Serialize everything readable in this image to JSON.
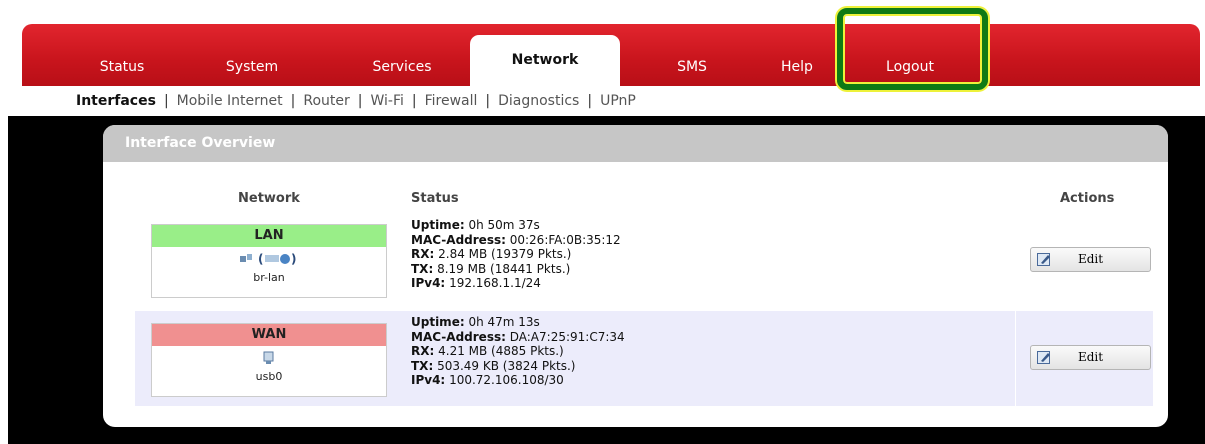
{
  "nav": {
    "tabs": [
      {
        "label": "Status"
      },
      {
        "label": "System"
      },
      {
        "label": "Services"
      },
      {
        "label": "Network",
        "active": true
      },
      {
        "label": "SMS"
      },
      {
        "label": "Help"
      },
      {
        "label": "Logout"
      }
    ]
  },
  "submenu": {
    "items": [
      "Interfaces",
      "Mobile Internet",
      "Router",
      "Wi-Fi",
      "Firewall",
      "Diagnostics",
      "UPnP"
    ],
    "active": "Interfaces"
  },
  "panel": {
    "title": "Interface Overview",
    "columns": {
      "network": "Network",
      "status": "Status",
      "actions": "Actions"
    },
    "rows": [
      {
        "name": "LAN",
        "color": "#99ee88",
        "icons": "(  )",
        "ifname": "br-lan",
        "uptime_label": "Uptime:",
        "uptime": "0h 50m 37s",
        "mac_label": "MAC-Address:",
        "mac": "00:26:FA:0B:35:12",
        "rx_label": "RX:",
        "rx": "2.84 MB (19379 Pkts.)",
        "tx_label": "TX:",
        "tx": "8.19 MB (18441 Pkts.)",
        "ipv4_label": "IPv4:",
        "ipv4": "192.168.1.1/24",
        "edit_label": "Edit"
      },
      {
        "name": "WAN",
        "color": "#f09090",
        "icons": "",
        "ifname": "usb0",
        "uptime_label": "Uptime:",
        "uptime": "0h 47m 13s",
        "mac_label": "MAC-Address:",
        "mac": "DA:A7:25:91:C7:34",
        "rx_label": "RX:",
        "rx": "4.21 MB (4885 Pkts.)",
        "tx_label": "TX:",
        "tx": "503.49 KB (3824 Pkts.)",
        "ipv4_label": "IPv4:",
        "ipv4": "100.72.106.108/30",
        "edit_label": "Edit"
      }
    ]
  },
  "colors": {
    "nav_red": "#d31b23",
    "highlight_green": "#0f7a14",
    "highlight_yellow": "#eef23a"
  }
}
